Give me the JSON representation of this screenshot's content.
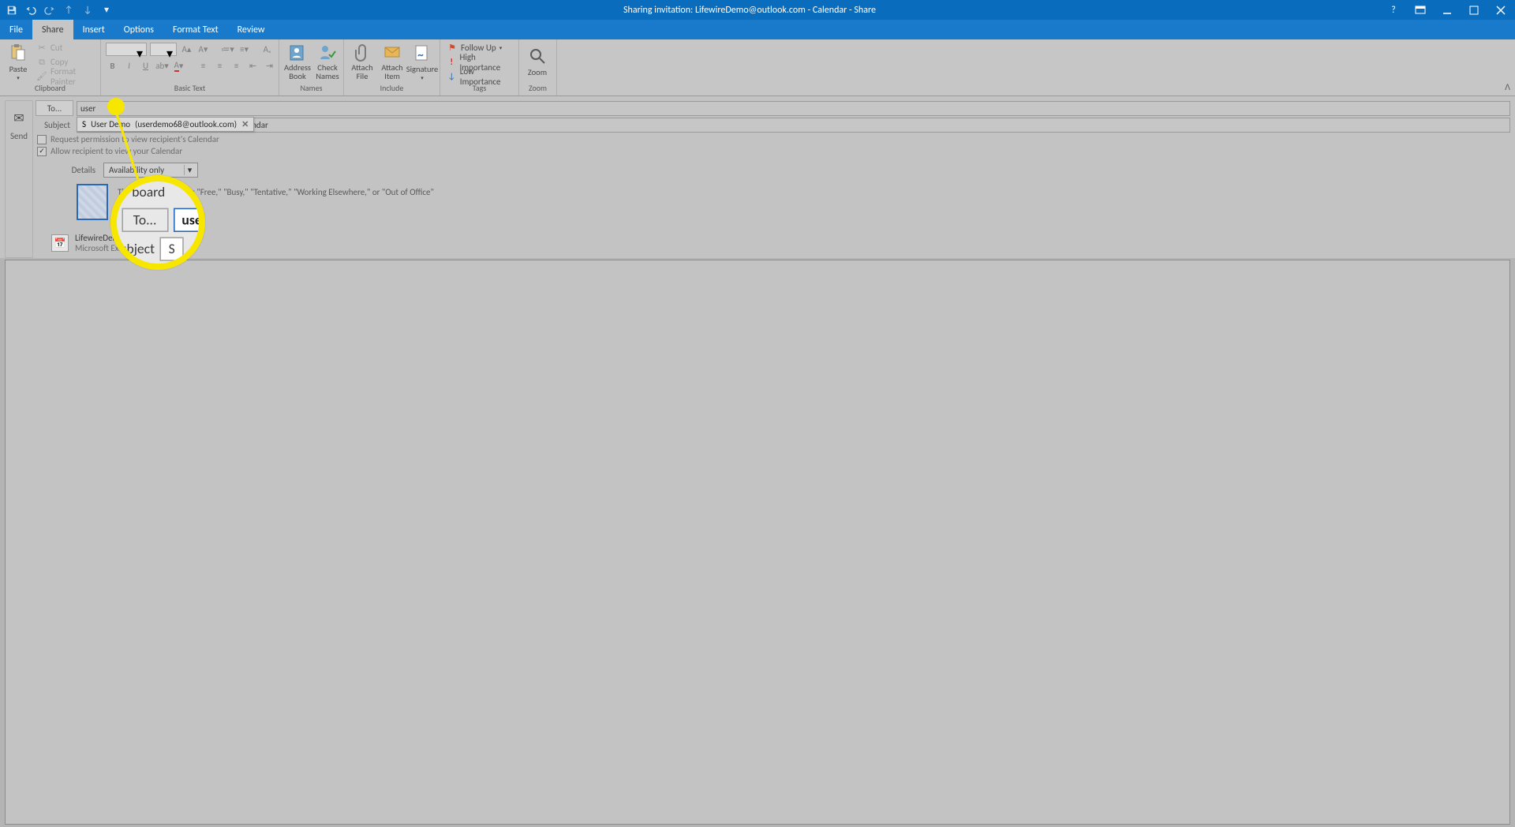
{
  "title": "Sharing invitation: LifewireDemo@outlook.com - Calendar  -  Share",
  "tabs": [
    "File",
    "Share",
    "Insert",
    "Options",
    "Format Text",
    "Review"
  ],
  "active_tab_index": 1,
  "clipboard": {
    "paste": "Paste",
    "cut": "Cut",
    "copy": "Copy",
    "painter": "Format Painter",
    "label": "Clipboard"
  },
  "basic_text": {
    "label": "Basic Text"
  },
  "names": {
    "address_book": "Address\nBook",
    "check_names": "Check\nNames",
    "label": "Names"
  },
  "include": {
    "attach_file": "Attach\nFile",
    "attach_item": "Attach\nItem",
    "signature": "Signature",
    "label": "Include"
  },
  "tags": {
    "follow_up": "Follow Up",
    "high": "High Importance",
    "low": "Low Importance",
    "label": "Tags"
  },
  "zoom": {
    "zoom": "Zoom",
    "label": "Zoom"
  },
  "form": {
    "send": "Send",
    "to": "To...",
    "to_value": "user",
    "subject": "Subject",
    "subject_value": "S",
    "subject_rest": "Calendar",
    "autocomplete_name": "User Demo",
    "autocomplete_email": "(userdemo68@outlook.com)",
    "request_perm": "Request permission to view recipient's Calendar",
    "allow_view": "Allow recipient to view your Calendar",
    "details": "Details",
    "details_value": "Availability only",
    "preview_text": "Time will be shown as \"Free,\" \"Busy,\" \"Tentative,\" \"Working Elsewhere,\" or \"Out of Office\"",
    "cal_name": "LifewireDemo@outlook.com",
    "cal_sub": "Microsoft Exchange Calendar"
  },
  "magnifier": {
    "board": "board",
    "to": "To...",
    "to_val": "user",
    "subject": "ubject",
    "subject_val": "S"
  }
}
